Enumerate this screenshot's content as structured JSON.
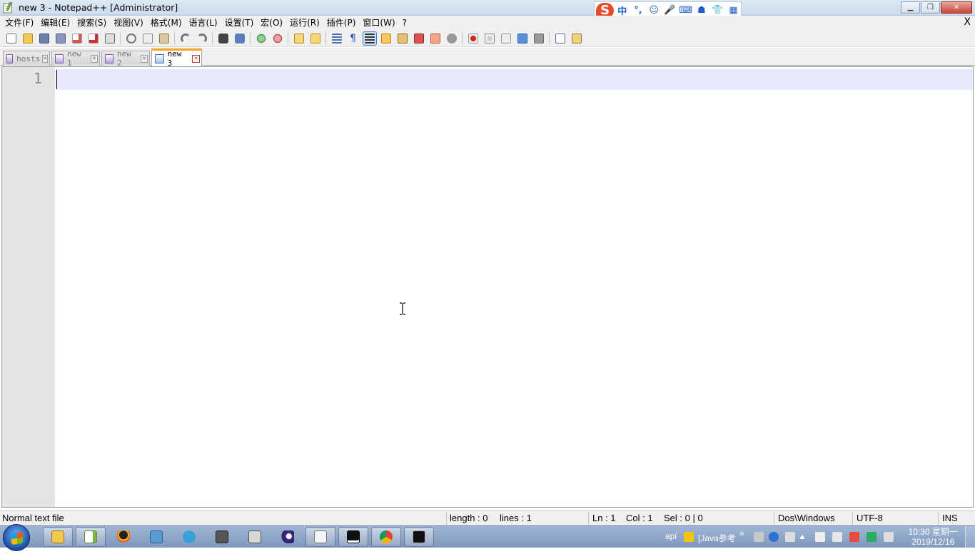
{
  "window": {
    "title": "new 3 - Notepad++ [Administrator]",
    "min_label": "▁",
    "restore_label": "❐",
    "close_label": "✕"
  },
  "ime": {
    "logo": "S",
    "items": [
      "中",
      "°,",
      "☺",
      "🎤",
      "⌨",
      "☗",
      "👕",
      "▦"
    ]
  },
  "menu": {
    "items": [
      "文件(F)",
      "编辑(E)",
      "搜索(S)",
      "视图(V)",
      "格式(M)",
      "语言(L)",
      "设置(T)",
      "宏(O)",
      "运行(R)",
      "插件(P)",
      "窗口(W)",
      "?"
    ],
    "close_label": "X"
  },
  "toolbar": {
    "icons": [
      "new-file-icon",
      "open-file-icon",
      "save-icon",
      "save-all-icon",
      "close-icon",
      "close-all-icon",
      "print-icon",
      "cut-icon",
      "copy-icon",
      "paste-icon",
      "undo-icon",
      "redo-icon",
      "find-icon",
      "replace-icon",
      "zoom-in-icon",
      "zoom-out-icon",
      "sync-vertical-icon",
      "sync-horizontal-icon",
      "word-wrap-icon",
      "show-all-chars-icon",
      "indent-guide-icon",
      "doc-map-icon",
      "function-list-icon",
      "folder-as-workspace-icon",
      "monitoring-icon",
      "record-macro-icon",
      "stop-macro-icon",
      "play-macro-icon",
      "run-macro-multiple-icon",
      "save-macro-icon",
      "run-icon",
      "plugin-icon"
    ]
  },
  "tabs": [
    {
      "label": "hosts",
      "active": false
    },
    {
      "label": "new 1",
      "active": false
    },
    {
      "label": "new 2",
      "active": false
    },
    {
      "label": "new 3",
      "active": true
    }
  ],
  "editor": {
    "line_number": "1",
    "content": ""
  },
  "status": {
    "file_type": "Normal text file",
    "length": "length : 0",
    "lines": "lines : 1",
    "ln": "Ln : 1",
    "col": "Col : 1",
    "sel": "Sel : 0 | 0",
    "eol": "Dos\\Windows",
    "encoding": "UTF-8",
    "mode": "INS"
  },
  "taskbar": {
    "apps": [
      "file-explorer-icon",
      "notepadpp-icon",
      "qq-icon",
      "remote-desktop-icon",
      "network-icon",
      "media-icon",
      "window-manager-icon",
      "eclipse-icon",
      "typora-icon",
      "intellij-icon",
      "chrome-icon",
      "cmd-icon"
    ],
    "tray_text_api": "api",
    "tray_text_java": "[Java参考",
    "tray_chevron": "»",
    "clock_time": "10:30 星期一",
    "clock_date": "2019/12/16"
  },
  "colors": {
    "current_line": "#e8e8ff",
    "gutter": "#e4e4e4",
    "active_tab_accent": "#f5a623"
  }
}
